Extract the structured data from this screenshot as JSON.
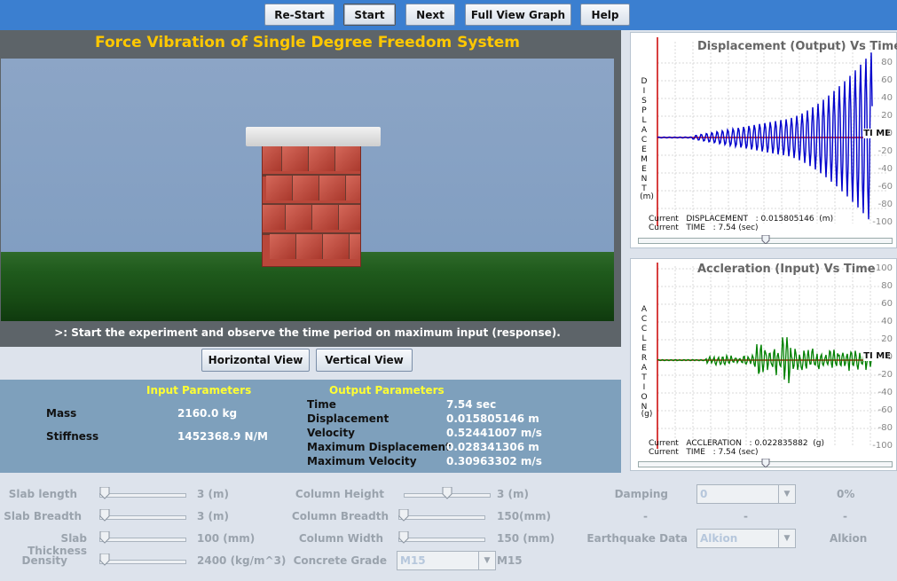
{
  "toolbar": {
    "restart_label": "Re-Start",
    "start_label": "Start",
    "next_label": "Next",
    "full_view_label": "Full View Graph",
    "help_label": "Help"
  },
  "simulation": {
    "title": "Force Vibration of Single Degree Freedom System",
    "instruction": ">: Start the experiment and observe the time period on maximum input (response)."
  },
  "views": {
    "horizontal_label": "Horizontal View",
    "vertical_label": "Vertical View"
  },
  "input_params": {
    "heading": "Input  Parameters",
    "rows": [
      {
        "label": "Mass",
        "value": "2160.0 kg"
      },
      {
        "label": "Stiffness",
        "value": "1452368.9 N/M"
      }
    ]
  },
  "output_params": {
    "heading": "Output  Parameters",
    "rows": [
      {
        "label": "Time",
        "value": "7.54 sec"
      },
      {
        "label": "Displacement",
        "value": "0.015805146 m"
      },
      {
        "label": "Velocity",
        "value": "0.52441007 m/s"
      },
      {
        "label": "Maximum Displacement",
        "value": "0.028341306 m"
      },
      {
        "label": "Maximum Velocity",
        "value": "0.30963302 m/s"
      }
    ]
  },
  "graph_displacement": {
    "title": "Displacement (Output) Vs Time",
    "vertical_label": [
      "D",
      "I",
      "S",
      "P",
      "L",
      "A",
      "C",
      "E",
      "M",
      "E",
      "N",
      "T"
    ],
    "unit": "(m)",
    "time_label": "TI ME",
    "ticks": [
      "80",
      "60",
      "40",
      "20",
      "0",
      "-20",
      "-40",
      "-60",
      "-80",
      "-100"
    ],
    "current_line1": "Current   DISPLACEMENT   : 0.015805146  (m)",
    "current_line2": "Current   TIME   : 7.54 (sec)",
    "slider_fraction": 0.5,
    "line_color": "#0000cc"
  },
  "graph_acceleration": {
    "title": "Accleration (Input) Vs Time",
    "vertical_label": [
      "A",
      "C",
      "C",
      "L",
      "E",
      "R",
      "A",
      "T",
      "I",
      "O",
      "N"
    ],
    "unit": "(g)",
    "time_label": "TI ME",
    "ticks": [
      "100",
      "80",
      "60",
      "40",
      "20",
      "0",
      "-20",
      "-40",
      "-60",
      "-80",
      "-100"
    ],
    "current_line1": "Current   ACCLERATION   : 0.022835882  (g)",
    "current_line2": "Current   TIME   : 7.54 (sec)",
    "slider_fraction": 0.5,
    "line_color": "#008000"
  },
  "controls": {
    "slab_length": {
      "label": "Slab length",
      "value": "3 (m)"
    },
    "slab_breadth": {
      "label": "Slab Breadth",
      "value": "3 (m)"
    },
    "slab_thickness": {
      "label": "Slab Thickness",
      "value": "100 (mm)"
    },
    "density": {
      "label": "Density",
      "value": "2400 (kg/m^3)"
    },
    "column_height": {
      "label": "Column Height",
      "value": "3 (m)"
    },
    "column_breadth": {
      "label": "Column Breadth",
      "value": "150(mm)"
    },
    "column_width": {
      "label": "Column Width",
      "value": "150 (mm)"
    },
    "concrete_grade": {
      "label": "Concrete Grade",
      "selected": "M15",
      "value": "M15"
    },
    "damping": {
      "label": "Damping",
      "selected": "0",
      "value": "0%"
    },
    "dash_row": [
      "-",
      "-",
      "-"
    ],
    "earthquake": {
      "label": "Earthquake Data",
      "selected": "Alkion",
      "value": "Alkion"
    }
  },
  "colors": {
    "toolbar_bg": "#3b7fd0",
    "title_color": "#ffc800",
    "param_heading": "#ffff33",
    "red_axis": "#cc0000"
  }
}
